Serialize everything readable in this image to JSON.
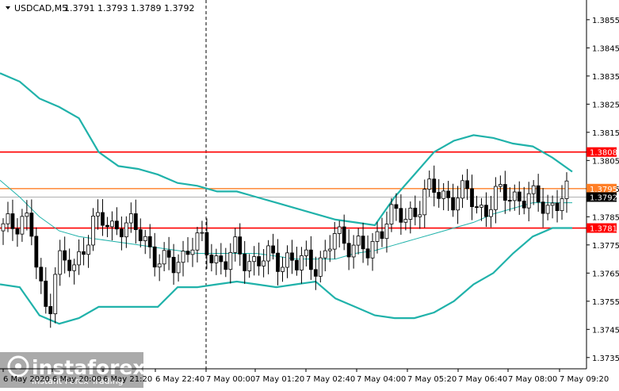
{
  "header": {
    "symbol_tf": "USDCAD,M5",
    "ohlc": "1.3791 1.3793 1.3789 1.3792"
  },
  "watermark": {
    "brand": "instaforex",
    "tagline": "Instant Forex Trading"
  },
  "colors": {
    "bands": "#20b2aa",
    "mid_band": "#20b2aa",
    "candle": "#000000",
    "resistance_line": "#ff0000",
    "pivot_line": "#ff7f27",
    "price_line": "#b0b0b0",
    "tag_red": "#ff0000",
    "tag_orange": "#ff7f27",
    "tag_current": "#000000"
  },
  "chart_data": {
    "type": "candlestick",
    "instrument": "USDCAD",
    "timeframe": "M5",
    "ylim": [
      1.3731,
      1.3862
    ],
    "y_ticks": [
      1.3855,
      1.3845,
      1.3835,
      1.3825,
      1.3815,
      1.3805,
      1.3795,
      1.3785,
      1.3775,
      1.3765,
      1.3755,
      1.3745,
      1.3735
    ],
    "x_ticks": [
      "6 May 2020",
      "6 May 20:00",
      "6 May 21:20",
      "6 May 22:40",
      "7 May 00:00",
      "7 May 01:20",
      "7 May 02:40",
      "7 May 04:00",
      "7 May 05:20",
      "7 May 06:40",
      "7 May 08:00",
      "7 May 09:20"
    ],
    "horizontal_levels": [
      {
        "label": "1.3808",
        "value": 1.3808,
        "color": "#ff0000"
      },
      {
        "label": "1.3795",
        "value": 1.3795,
        "color": "#ff7f27"
      },
      {
        "label": "1.3781",
        "value": 1.3781,
        "color": "#ff0000"
      }
    ],
    "current_price": {
      "label": "1.3792",
      "value": 1.3792
    },
    "day_separator": "7 May 00:00",
    "series": [
      {
        "name": "Upper Bollinger band",
        "values": [
          1.3836,
          1.3833,
          1.3827,
          1.3824,
          1.382,
          1.3808,
          1.3803,
          1.3802,
          1.38,
          1.3797,
          1.3796,
          1.3794,
          1.3794,
          1.3792,
          1.379,
          1.3788,
          1.3786,
          1.3784,
          1.3783,
          1.3782,
          1.3792,
          1.38,
          1.3808,
          1.3812,
          1.3814,
          1.3813,
          1.3811,
          1.381,
          1.3806,
          1.3801
        ]
      },
      {
        "name": "Middle band",
        "values": [
          1.3798,
          1.3792,
          1.3785,
          1.378,
          1.3778,
          1.3777,
          1.3776,
          1.3775,
          1.3774,
          1.3773,
          1.3772,
          1.3772,
          1.3772,
          1.3772,
          1.3771,
          1.377,
          1.377,
          1.377,
          1.3772,
          1.3773,
          1.3775,
          1.3777,
          1.3779,
          1.3781,
          1.3783,
          1.3786,
          1.3788,
          1.379,
          1.379,
          1.379
        ]
      },
      {
        "name": "Lower Bollinger band",
        "values": [
          1.3761,
          1.376,
          1.375,
          1.3747,
          1.3749,
          1.3753,
          1.3753,
          1.3753,
          1.3753,
          1.376,
          1.376,
          1.3761,
          1.3762,
          1.3761,
          1.376,
          1.3761,
          1.3762,
          1.3756,
          1.3753,
          1.375,
          1.3749,
          1.3749,
          1.3751,
          1.3755,
          1.3761,
          1.3765,
          1.3772,
          1.3778,
          1.3781,
          1.3781
        ]
      }
    ],
    "close_path": [
      1.378,
      1.3782,
      1.3786,
      1.3783,
      1.376,
      1.375,
      1.3771,
      1.3768,
      1.3765,
      1.3776,
      1.3783,
      1.3783,
      1.378,
      1.3784,
      1.3782,
      1.3779,
      1.3776,
      1.3772,
      1.3768,
      1.3767,
      1.3771,
      1.3777,
      1.3775,
      1.3772,
      1.377,
      1.377,
      1.3772,
      1.377,
      1.377,
      1.377,
      1.3769,
      1.377,
      1.3771,
      1.3767,
      1.3769,
      1.3769,
      1.3771,
      1.3778,
      1.3776,
      1.3777,
      1.3774,
      1.377,
      1.378,
      1.3787,
      1.3785,
      1.3783,
      1.3788,
      1.3793,
      1.3794,
      1.3792,
      1.3793,
      1.3792,
      1.3793,
      1.3788,
      1.3789,
      1.3791,
      1.3793,
      1.3793,
      1.3792,
      1.379,
      1.3791,
      1.3789,
      1.379,
      1.3792
    ],
    "grid": false,
    "legend": "none"
  }
}
